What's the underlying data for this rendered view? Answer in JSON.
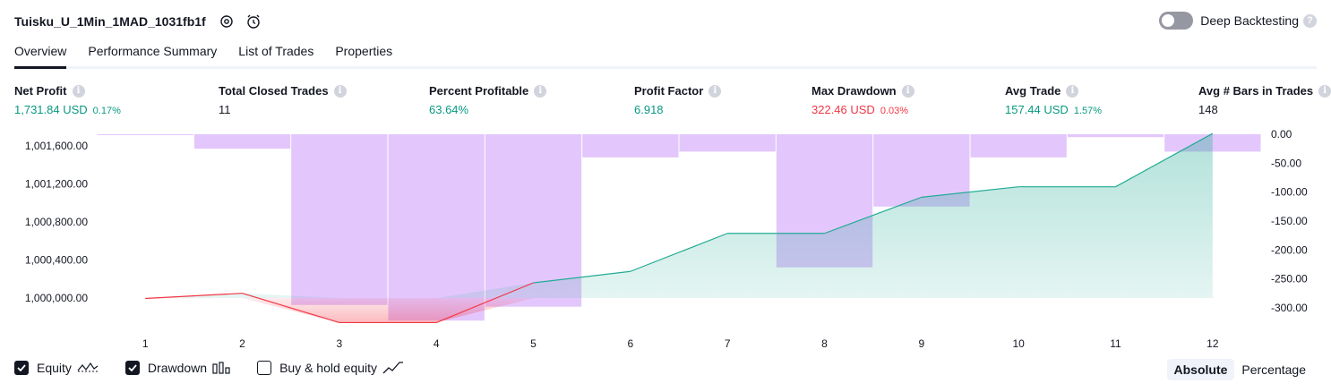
{
  "header": {
    "title": "Tuisku_U_1Min_1MAD_1031fb1f"
  },
  "deep_backtesting": {
    "label": "Deep Backtesting",
    "enabled": false,
    "help": "?"
  },
  "tabs": [
    {
      "label": "Overview",
      "active": true
    },
    {
      "label": "Performance Summary",
      "active": false
    },
    {
      "label": "List of Trades",
      "active": false
    },
    {
      "label": "Properties",
      "active": false
    }
  ],
  "metrics": {
    "info_glyph": "i",
    "net_profit": {
      "label": "Net Profit",
      "value": "1,731.84 USD",
      "pct": "0.17%"
    },
    "total_closed_trades": {
      "label": "Total Closed Trades",
      "value": "11"
    },
    "percent_profitable": {
      "label": "Percent Profitable",
      "value": "63.64%"
    },
    "profit_factor": {
      "label": "Profit Factor",
      "value": "6.918"
    },
    "max_drawdown": {
      "label": "Max Drawdown",
      "value": "322.46 USD",
      "pct": "0.03%"
    },
    "avg_trade": {
      "label": "Avg Trade",
      "value": "157.44 USD",
      "pct": "1.57%"
    },
    "avg_bars": {
      "label": "Avg # Bars in Trades",
      "value": "148"
    }
  },
  "colors": {
    "profit": "#089981",
    "loss": "#f23645",
    "drawdown_bar": "#e1c4fc",
    "equity_fill": "#d5f0e8",
    "equity_line": "#22ab94"
  },
  "chart_data": {
    "type": "line",
    "x": [
      "1",
      "2",
      "3",
      "4",
      "5",
      "6",
      "7",
      "8",
      "9",
      "10",
      "11",
      "12"
    ],
    "series": [
      {
        "name": "Equity",
        "axis": "left",
        "values": [
          999995,
          1000050,
          999742,
          999742,
          1000160,
          1000280,
          1000680,
          1000680,
          1001060,
          1001170,
          1001170,
          1001730
        ]
      },
      {
        "name": "Drawdown",
        "axis": "right",
        "type": "bar",
        "values": [
          0,
          -25,
          -295,
          -322,
          -298,
          -40,
          -30,
          -230,
          -125,
          -40,
          -5,
          -30
        ]
      }
    ],
    "y_left": {
      "ticks": [
        "1,001,600.00",
        "1,001,200.00",
        "1,000,800.00",
        "1,000,400.00",
        "1,000,000.00"
      ],
      "tick_values": [
        1001600,
        1001200,
        1000800,
        1000400,
        1000000
      ]
    },
    "y_right": {
      "ticks": [
        "0.00",
        "-50.00",
        "-100.00",
        "-150.00",
        "-200.00",
        "-250.00",
        "-300.00"
      ],
      "tick_values": [
        0,
        -50,
        -100,
        -150,
        -200,
        -250,
        -300
      ]
    }
  },
  "legend": {
    "items": [
      {
        "label": "Equity",
        "checked": true
      },
      {
        "label": "Drawdown",
        "checked": true
      },
      {
        "label": "Buy & hold equity",
        "checked": false
      }
    ]
  },
  "mode": {
    "absolute": "Absolute",
    "percentage": "Percentage",
    "selected": "Absolute"
  }
}
